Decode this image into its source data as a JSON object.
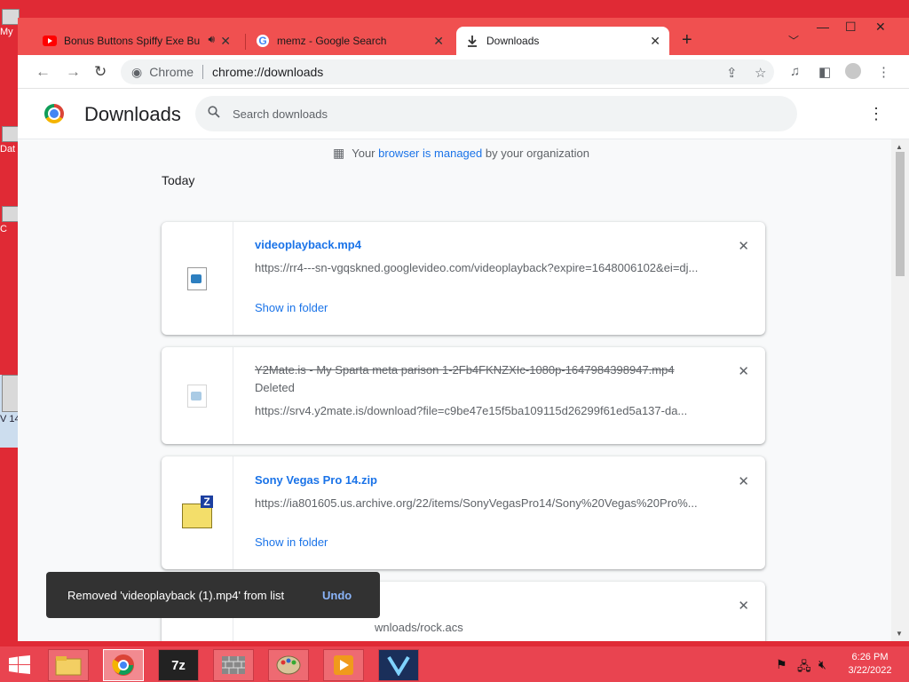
{
  "desktop": {
    "icons": [
      {
        "label": "My"
      },
      {
        "label": "Dat"
      },
      {
        "label": "C"
      },
      {
        "label": "V 14"
      }
    ]
  },
  "browser": {
    "tabs": [
      {
        "title": "Bonus Buttons Spiffy Exe Bu",
        "favicon": "youtube-icon",
        "audio": true,
        "active": false
      },
      {
        "title": "memz - Google Search",
        "favicon": "google-icon",
        "active": false
      },
      {
        "title": "Downloads",
        "favicon": "download-icon",
        "active": true
      }
    ],
    "new_tab": "+",
    "omnibox": {
      "site_label": "Chrome",
      "url": "chrome://downloads"
    }
  },
  "downloads_page": {
    "title": "Downloads",
    "search_placeholder": "Search downloads",
    "managed_notice": {
      "prefix": "Your",
      "link1": "browser",
      "middle": "is",
      "link2": "managed",
      "suffix": "by your organization"
    },
    "group_label": "Today",
    "items": [
      {
        "filename": "videoplayback.mp4",
        "url": "https://rr4---sn-vgqskned.googlevideo.com/videoplayback?expire=1648006102&ei=dj...",
        "action": "Show in folder",
        "deleted": false,
        "icon": "video-file-icon"
      },
      {
        "filename": "Y2Mate.is - My Sparta meta parison 1-2Fb4FKNZXIc-1080p-1647984398947.mp4",
        "status": "Deleted",
        "url": "https://srv4.y2mate.is/download?file=c9be47e15f5ba109115d26299f61ed5a137-da...",
        "deleted": true,
        "icon": "video-file-icon"
      },
      {
        "filename": "Sony Vegas Pro 14.zip",
        "url": "https://ia801605.us.archive.org/22/items/SonyVegasPro14/Sony%20Vegas%20Pro%...",
        "action": "Show in folder",
        "deleted": false,
        "icon": "zip-file-icon"
      },
      {
        "url_partial": "wnloads/rock.acs"
      }
    ]
  },
  "toast": {
    "message": "Removed 'videoplayback (1).mp4' from list",
    "undo_label": "Undo"
  },
  "taskbar": {
    "time": "6:26 PM",
    "date": "3/22/2022"
  }
}
